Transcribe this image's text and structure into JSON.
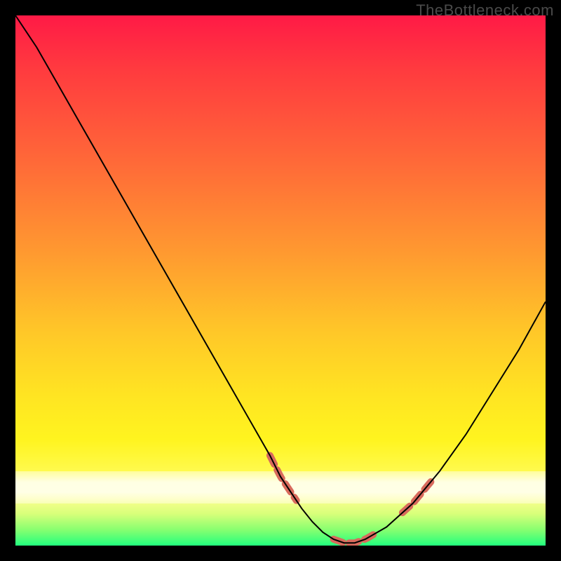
{
  "watermark": "TheBottleneck.com",
  "chart_data": {
    "type": "line",
    "title": "",
    "xlabel": "",
    "ylabel": "",
    "xlim": [
      0,
      100
    ],
    "ylim": [
      0,
      100
    ],
    "background_gradient": {
      "direction": "vertical",
      "stops": [
        {
          "pos": 0,
          "color": "#ff1a46"
        },
        {
          "pos": 10,
          "color": "#ff3a3f"
        },
        {
          "pos": 28,
          "color": "#ff6a38"
        },
        {
          "pos": 45,
          "color": "#ff9a30"
        },
        {
          "pos": 60,
          "color": "#ffc828"
        },
        {
          "pos": 72,
          "color": "#ffe522"
        },
        {
          "pos": 80,
          "color": "#fff41f"
        },
        {
          "pos": 87,
          "color": "#fffb55"
        },
        {
          "pos": 91,
          "color": "#fdff90"
        },
        {
          "pos": 94,
          "color": "#d8ff7a"
        },
        {
          "pos": 97,
          "color": "#88ff70"
        },
        {
          "pos": 100,
          "color": "#22ff7e"
        }
      ]
    },
    "pale_band": {
      "from_pct": 86,
      "to_pct": 92,
      "color": "#ffffe6"
    },
    "series": [
      {
        "name": "curve",
        "stroke": "#000000",
        "x": [
          0,
          4,
          8,
          12,
          16,
          20,
          24,
          28,
          32,
          36,
          40,
          44,
          48,
          50,
          52,
          54,
          56,
          58,
          60,
          62,
          64,
          66,
          70,
          75,
          80,
          85,
          90,
          95,
          100
        ],
        "y": [
          100,
          94,
          87,
          80,
          73,
          66,
          59,
          52,
          45,
          38,
          31,
          24,
          17,
          13,
          10,
          7,
          4.5,
          2.5,
          1.2,
          0.5,
          0.5,
          1.2,
          3.5,
          8,
          14,
          21,
          29,
          37,
          46
        ]
      }
    ],
    "highlight_segments": {
      "color": "#d86a5c",
      "stroke_width": 10,
      "ranges_x": [
        [
          48,
          53
        ],
        [
          60,
          68
        ],
        [
          73,
          79
        ]
      ]
    }
  }
}
